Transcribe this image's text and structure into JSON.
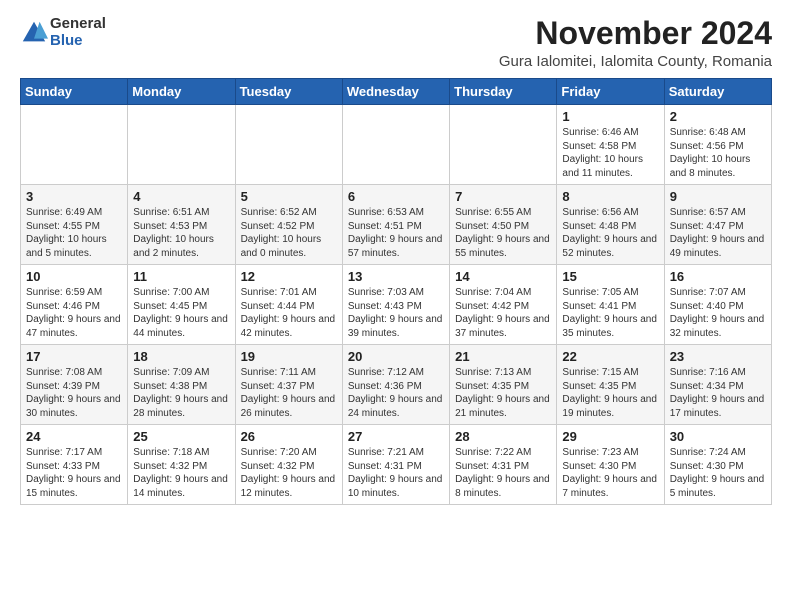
{
  "logo": {
    "general": "General",
    "blue": "Blue"
  },
  "header": {
    "month": "November 2024",
    "location": "Gura Ialomitei, Ialomita County, Romania"
  },
  "weekdays": [
    "Sunday",
    "Monday",
    "Tuesday",
    "Wednesday",
    "Thursday",
    "Friday",
    "Saturday"
  ],
  "weeks": [
    [
      {
        "day": "",
        "info": ""
      },
      {
        "day": "",
        "info": ""
      },
      {
        "day": "",
        "info": ""
      },
      {
        "day": "",
        "info": ""
      },
      {
        "day": "",
        "info": ""
      },
      {
        "day": "1",
        "info": "Sunrise: 6:46 AM\nSunset: 4:58 PM\nDaylight: 10 hours and 11 minutes."
      },
      {
        "day": "2",
        "info": "Sunrise: 6:48 AM\nSunset: 4:56 PM\nDaylight: 10 hours and 8 minutes."
      }
    ],
    [
      {
        "day": "3",
        "info": "Sunrise: 6:49 AM\nSunset: 4:55 PM\nDaylight: 10 hours and 5 minutes."
      },
      {
        "day": "4",
        "info": "Sunrise: 6:51 AM\nSunset: 4:53 PM\nDaylight: 10 hours and 2 minutes."
      },
      {
        "day": "5",
        "info": "Sunrise: 6:52 AM\nSunset: 4:52 PM\nDaylight: 10 hours and 0 minutes."
      },
      {
        "day": "6",
        "info": "Sunrise: 6:53 AM\nSunset: 4:51 PM\nDaylight: 9 hours and 57 minutes."
      },
      {
        "day": "7",
        "info": "Sunrise: 6:55 AM\nSunset: 4:50 PM\nDaylight: 9 hours and 55 minutes."
      },
      {
        "day": "8",
        "info": "Sunrise: 6:56 AM\nSunset: 4:48 PM\nDaylight: 9 hours and 52 minutes."
      },
      {
        "day": "9",
        "info": "Sunrise: 6:57 AM\nSunset: 4:47 PM\nDaylight: 9 hours and 49 minutes."
      }
    ],
    [
      {
        "day": "10",
        "info": "Sunrise: 6:59 AM\nSunset: 4:46 PM\nDaylight: 9 hours and 47 minutes."
      },
      {
        "day": "11",
        "info": "Sunrise: 7:00 AM\nSunset: 4:45 PM\nDaylight: 9 hours and 44 minutes."
      },
      {
        "day": "12",
        "info": "Sunrise: 7:01 AM\nSunset: 4:44 PM\nDaylight: 9 hours and 42 minutes."
      },
      {
        "day": "13",
        "info": "Sunrise: 7:03 AM\nSunset: 4:43 PM\nDaylight: 9 hours and 39 minutes."
      },
      {
        "day": "14",
        "info": "Sunrise: 7:04 AM\nSunset: 4:42 PM\nDaylight: 9 hours and 37 minutes."
      },
      {
        "day": "15",
        "info": "Sunrise: 7:05 AM\nSunset: 4:41 PM\nDaylight: 9 hours and 35 minutes."
      },
      {
        "day": "16",
        "info": "Sunrise: 7:07 AM\nSunset: 4:40 PM\nDaylight: 9 hours and 32 minutes."
      }
    ],
    [
      {
        "day": "17",
        "info": "Sunrise: 7:08 AM\nSunset: 4:39 PM\nDaylight: 9 hours and 30 minutes."
      },
      {
        "day": "18",
        "info": "Sunrise: 7:09 AM\nSunset: 4:38 PM\nDaylight: 9 hours and 28 minutes."
      },
      {
        "day": "19",
        "info": "Sunrise: 7:11 AM\nSunset: 4:37 PM\nDaylight: 9 hours and 26 minutes."
      },
      {
        "day": "20",
        "info": "Sunrise: 7:12 AM\nSunset: 4:36 PM\nDaylight: 9 hours and 24 minutes."
      },
      {
        "day": "21",
        "info": "Sunrise: 7:13 AM\nSunset: 4:35 PM\nDaylight: 9 hours and 21 minutes."
      },
      {
        "day": "22",
        "info": "Sunrise: 7:15 AM\nSunset: 4:35 PM\nDaylight: 9 hours and 19 minutes."
      },
      {
        "day": "23",
        "info": "Sunrise: 7:16 AM\nSunset: 4:34 PM\nDaylight: 9 hours and 17 minutes."
      }
    ],
    [
      {
        "day": "24",
        "info": "Sunrise: 7:17 AM\nSunset: 4:33 PM\nDaylight: 9 hours and 15 minutes."
      },
      {
        "day": "25",
        "info": "Sunrise: 7:18 AM\nSunset: 4:32 PM\nDaylight: 9 hours and 14 minutes."
      },
      {
        "day": "26",
        "info": "Sunrise: 7:20 AM\nSunset: 4:32 PM\nDaylight: 9 hours and 12 minutes."
      },
      {
        "day": "27",
        "info": "Sunrise: 7:21 AM\nSunset: 4:31 PM\nDaylight: 9 hours and 10 minutes."
      },
      {
        "day": "28",
        "info": "Sunrise: 7:22 AM\nSunset: 4:31 PM\nDaylight: 9 hours and 8 minutes."
      },
      {
        "day": "29",
        "info": "Sunrise: 7:23 AM\nSunset: 4:30 PM\nDaylight: 9 hours and 7 minutes."
      },
      {
        "day": "30",
        "info": "Sunrise: 7:24 AM\nSunset: 4:30 PM\nDaylight: 9 hours and 5 minutes."
      }
    ]
  ]
}
